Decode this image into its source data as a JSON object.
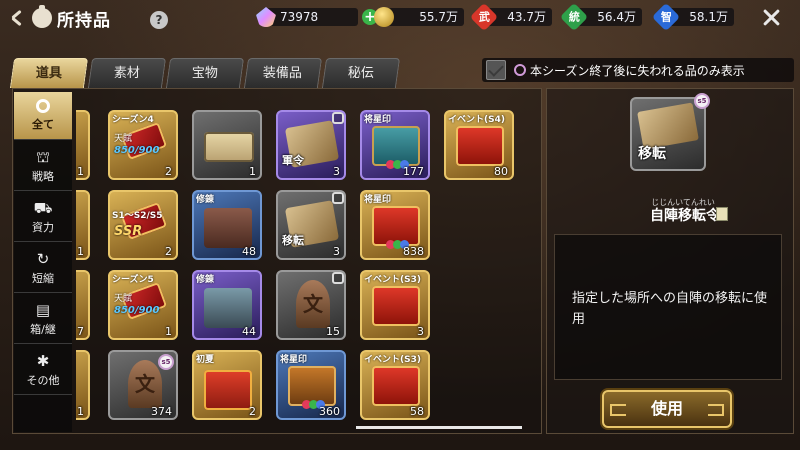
{
  "header": {
    "title": "所持品",
    "help": "?"
  },
  "resources": {
    "gems": "73978",
    "gold": "55.7万",
    "stats": [
      {
        "glyph": "武",
        "value": "43.7万",
        "color": "#d8362a"
      },
      {
        "glyph": "統",
        "value": "56.4万",
        "color": "#2ea04a"
      },
      {
        "glyph": "智",
        "value": "58.1万",
        "color": "#2a6ad8"
      }
    ]
  },
  "tabs": [
    "道具",
    "素材",
    "宝物",
    "装備品",
    "秘伝"
  ],
  "filter": {
    "label": "本シーズン終了後に失われる品のみ表示"
  },
  "categories": [
    {
      "label": "全て",
      "glyph": ""
    },
    {
      "label": "戦略",
      "glyph": "⛫"
    },
    {
      "label": "資力",
      "glyph": "⛟"
    },
    {
      "label": "短縮",
      "glyph": "↻"
    },
    {
      "label": "箱/継",
      "glyph": "▤"
    },
    {
      "label": "その他",
      "glyph": "✱"
    }
  ],
  "items": {
    "c0": {
      "counts": [
        "1",
        "1",
        "7",
        "1"
      ]
    },
    "c1": [
      {
        "top": "シーズン4",
        "sub1": "天賦",
        "sub2": "850/900",
        "count": "2"
      },
      {
        "top": "S1〜S2/S5",
        "sub1": "",
        "sub2": "SSR",
        "count": "2"
      },
      {
        "top": "シーズン5",
        "sub1": "天賦",
        "sub2": "850/900",
        "count": "1"
      },
      {
        "count": "374",
        "tag": "s5"
      }
    ],
    "c2": [
      {
        "count": "1"
      },
      {
        "top": "修錬",
        "count": "48"
      },
      {
        "top": "修錬",
        "count": "44"
      },
      {
        "top": "初夏",
        "count": "2"
      }
    ],
    "c3": [
      {
        "name": "軍令",
        "count": "3"
      },
      {
        "name": "移転",
        "count": "3"
      },
      {
        "count": "15"
      },
      {
        "top": "将星印",
        "count": "360"
      }
    ],
    "c4": [
      {
        "top": "将星印",
        "count": "177"
      },
      {
        "top": "将星印",
        "count": "838"
      },
      {
        "top": "イベント(S3)",
        "count": "3"
      },
      {
        "top": "イベント(S3)",
        "count": "58"
      }
    ],
    "c5": [
      {
        "top": "イベント(S4)",
        "count": "80"
      }
    ]
  },
  "detail": {
    "icon_label": "移転",
    "season_tag": "s5",
    "ruby": "じじんいてんれい",
    "title": "自陣移転令",
    "description": "指定した場所への自陣の移転に使用",
    "use_button": "使用"
  }
}
